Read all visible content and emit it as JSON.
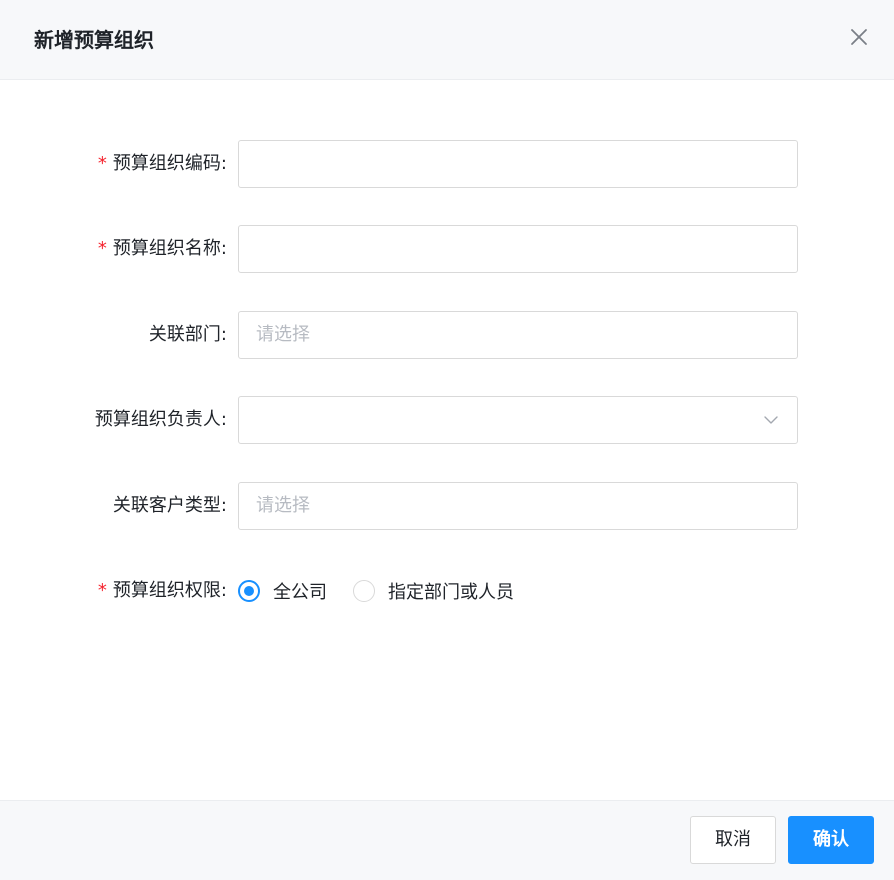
{
  "dialog": {
    "title": "新增预算组织"
  },
  "form": {
    "code": {
      "label": "预算组织编码:",
      "required": true,
      "value": "",
      "placeholder": ""
    },
    "name": {
      "label": "预算组织名称:",
      "required": true,
      "value": "",
      "placeholder": ""
    },
    "department": {
      "label": "关联部门:",
      "required": false,
      "placeholder": "请选择"
    },
    "owner": {
      "label": "预算组织负责人:",
      "required": false,
      "value": ""
    },
    "customer_type": {
      "label": "关联客户类型:",
      "required": false,
      "placeholder": "请选择"
    },
    "permission": {
      "label": "预算组织权限:",
      "required": true,
      "options": [
        {
          "label": "全公司",
          "checked": true
        },
        {
          "label": "指定部门或人员",
          "checked": false
        }
      ]
    }
  },
  "footer": {
    "cancel_label": "取消",
    "ok_label": "确认"
  },
  "colors": {
    "primary": "#1890ff",
    "required": "#f5222d",
    "border": "#d9d9d9",
    "placeholder": "#b7bbc2",
    "header_bg": "#f7f8fa"
  }
}
